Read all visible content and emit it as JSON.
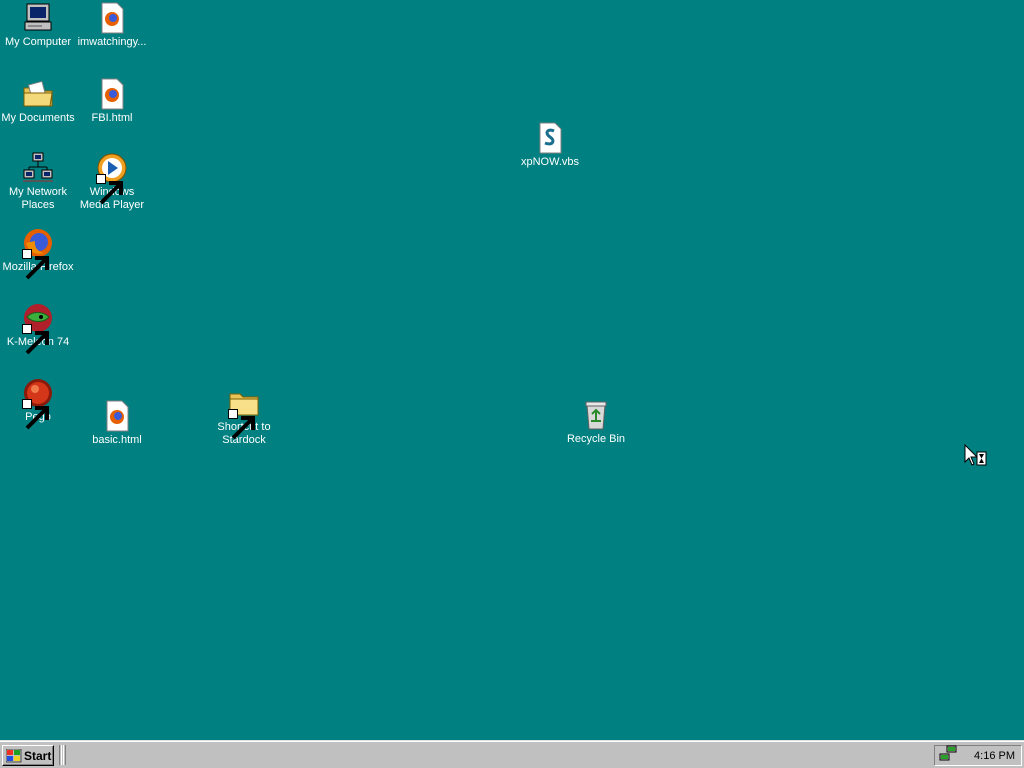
{
  "desktop": {
    "background": "#008080",
    "icons": {
      "my_computer": "My Computer",
      "imwatching": "imwatchingy...",
      "my_documents": "My Documents",
      "fbi_html": "FBI.html",
      "network_l1": "My Network",
      "network_l2": "Places",
      "wmp_l1": "Windows",
      "wmp_l2": "Media Player",
      "firefox": "Mozilla Firefox",
      "kmeleon": "K-Meleon 74",
      "pego": "Pego",
      "basic_html": "basic.html",
      "stardock_l1": "Shortcut to",
      "stardock_l2": "Stardock",
      "xpnow": "xpNOW.vbs",
      "recycle_bin": "Recycle Bin"
    }
  },
  "taskbar": {
    "start_label": "Start",
    "clock": "4:16 PM",
    "tray_icon": "network-tray-icon"
  },
  "cursor": "busy-cursor-icon"
}
